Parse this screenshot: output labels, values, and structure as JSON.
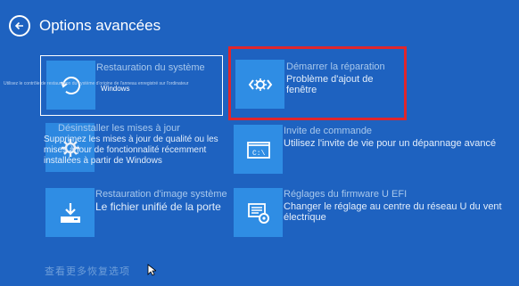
{
  "header": {
    "title": "Options avancées"
  },
  "tiles": [
    {
      "title": "Restauration du système",
      "desc": "",
      "ghost": "Utilisez le contrôle de restauration du système d'origine de l'anneau enregistré sur l'ordinateur",
      "overlay": "Windows",
      "icon": "system-restore-icon"
    },
    {
      "title": "Démarrer la réparation",
      "desc": "Problème d'ajout de fenêtre",
      "icon": "startup-repair-icon"
    },
    {
      "title": "Désinstaller les mises à jour",
      "desc": "Supprimez les mises à jour de qualité ou les mises à jour de fonctionnalité récemment installées à partir de Windows",
      "icon": "gear-icon"
    },
    {
      "title": "Invite de commande",
      "desc": "Utilisez l'invite de vie pour un dépannage avancé",
      "icon": "command-prompt-icon"
    },
    {
      "title": "Restauration d'image système",
      "desc": "Le fichier unifié de la porte",
      "icon": "image-restore-icon"
    },
    {
      "title": "Réglages du firmware U EFI",
      "desc": "Changer le réglage au centre du réseau U du vent électrique",
      "icon": "firmware-settings-icon"
    }
  ],
  "footer": {
    "text": "查看更多恢复选项"
  },
  "colors": {
    "background": "#1e62c0",
    "tile_icon": "#2f8de4",
    "highlight": "#e0262c"
  }
}
